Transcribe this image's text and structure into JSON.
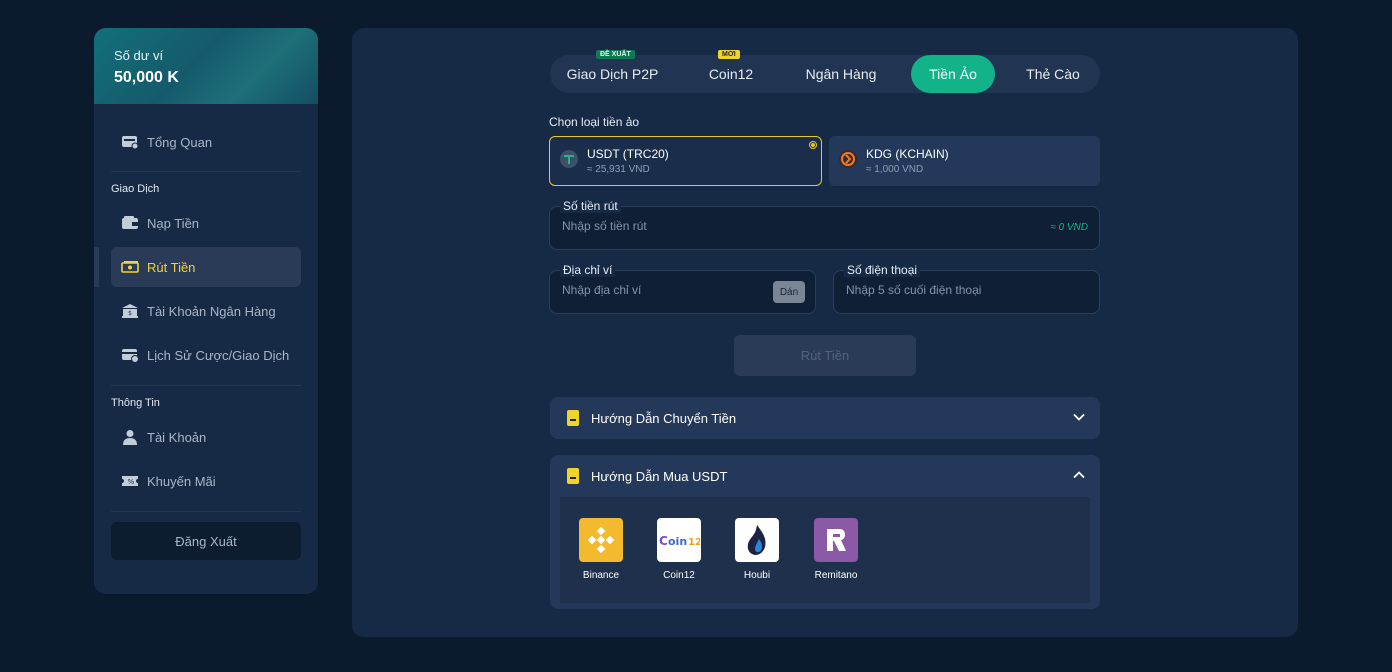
{
  "sidebar": {
    "balance_label": "Số dư ví",
    "balance_value": "50,000 K",
    "overview": "Tổng Quan",
    "section_transactions": "Giao Dịch",
    "deposit": "Nạp Tiền",
    "withdraw": "Rút Tiền",
    "bank_account": "Tài Khoản Ngân Hàng",
    "history": "Lịch Sử Cược/Giao Dịch",
    "section_info": "Thông Tin",
    "account": "Tài Khoản",
    "promotion": "Khuyến Mãi",
    "logout": "Đăng Xuất"
  },
  "tabs": {
    "p2p": "Giao Dịch P2P",
    "p2p_tag": "ĐỀ XUẤT",
    "coin12": "Coin12",
    "coin12_tag": "MỚI",
    "bank": "Ngân Hàng",
    "crypto": "Tiền Ảo",
    "card": "Thẻ Cào",
    "active": "Tiền Ảo"
  },
  "form": {
    "choose_label": "Chọn loại tiền ảo",
    "coins": [
      {
        "name": "USDT (TRC20)",
        "rate": "≈ 25,931 VND",
        "selected": true
      },
      {
        "name": "KDG (KCHAIN)",
        "rate": "≈ 1,000 VND",
        "selected": false
      }
    ],
    "amount_label": "Số tiền rút",
    "amount_placeholder": "Nhập số tiền rút",
    "amount_approx": "≈ 0 VND",
    "wallet_label": "Địa chỉ ví",
    "wallet_placeholder": "Nhập địa chỉ ví",
    "paste": "Dán",
    "phone_label": "Số điện thoại",
    "phone_placeholder": "Nhập 5 số cuối điện thoại",
    "submit": "Rút Tiền"
  },
  "guides": {
    "transfer_title": "Hướng Dẫn Chuyển Tiền",
    "buy_title": "Hướng Dẫn Mua USDT",
    "exchanges": [
      {
        "name": "Binance",
        "color": "#f3ba2f"
      },
      {
        "name": "Coin12",
        "color": "#ffffff"
      },
      {
        "name": "Houbi",
        "color": "#ffffff"
      },
      {
        "name": "Remitano",
        "color": "#8a5aa8"
      }
    ]
  },
  "colors": {
    "accent": "#13b38a",
    "highlight": "#f4d23a",
    "background": "#0c1a2e",
    "panel": "#172a45"
  }
}
